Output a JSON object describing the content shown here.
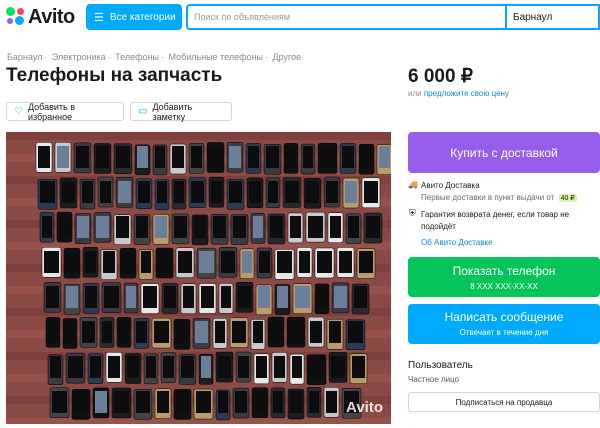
{
  "header": {
    "logo_text": "Avito",
    "categories_label": "Все категории",
    "search_placeholder": "Поиск по объявлениям",
    "city": "Барнаул"
  },
  "breadcrumbs": [
    "Барнаул",
    "Электроника",
    "Телефоны",
    "Мобильные телефоны",
    "Другое"
  ],
  "title": "Телефоны на запчасть",
  "actions": {
    "favorite_label": "Добавить в избранное",
    "note_label": "Добавить заметку"
  },
  "photo": {
    "watermark": "Avito"
  },
  "price": {
    "value": "6 000 ₽",
    "sub_prefix": "или",
    "sub_link": "предложите свою цену"
  },
  "buy_button": "Купить с доставкой",
  "delivery": {
    "title": "Авито Доставка",
    "subtitle": "Первые доставки в пункт выдачи от",
    "badge": "40 ₽",
    "guarantee": "Гарантия возврата денег, если товар не подойдёт",
    "about_link": "Об Авито Доставке"
  },
  "phone_button": {
    "label": "Показать телефон",
    "number": "8 XXX XXX-XX-XX"
  },
  "message_button": {
    "label": "Написать сообщение",
    "sub": "Отвечает в течение дня"
  },
  "seller": {
    "label": "Пользователь",
    "type": "Частное лицо",
    "subscribe": "Подписаться на продавца"
  }
}
